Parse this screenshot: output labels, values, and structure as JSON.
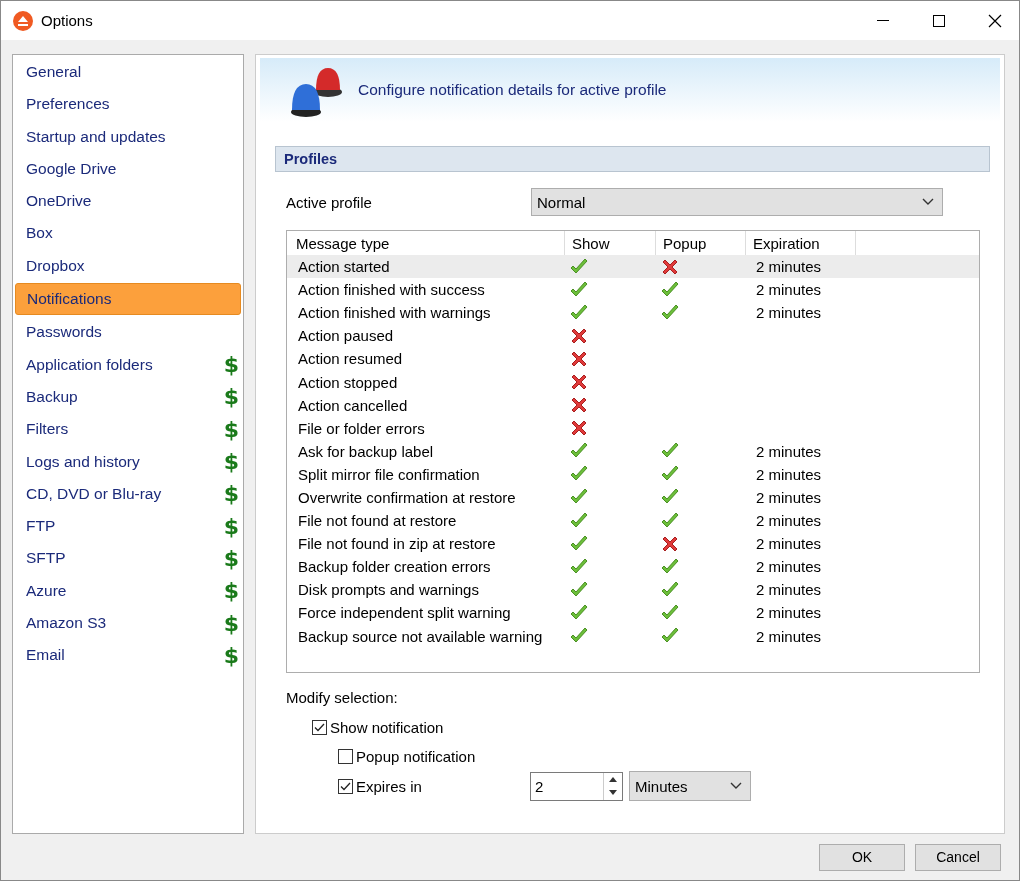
{
  "window": {
    "title": "Options"
  },
  "sidebar": {
    "items": [
      {
        "label": "General",
        "selected": false
      },
      {
        "label": "Preferences",
        "selected": false
      },
      {
        "label": "Startup and updates",
        "selected": false
      },
      {
        "label": "Google Drive",
        "selected": false
      },
      {
        "label": "OneDrive",
        "selected": false
      },
      {
        "label": "Box",
        "selected": false
      },
      {
        "label": "Dropbox",
        "selected": false
      },
      {
        "label": "Notifications",
        "selected": true
      },
      {
        "label": "Passwords",
        "selected": false
      },
      {
        "label": "Application folders",
        "selected": false,
        "badge": "$"
      },
      {
        "label": "Backup",
        "selected": false,
        "badge": "$"
      },
      {
        "label": "Filters",
        "selected": false,
        "badge": "$"
      },
      {
        "label": "Logs and history",
        "selected": false,
        "badge": "$"
      },
      {
        "label": "CD, DVD or Blu-ray",
        "selected": false,
        "badge": "$"
      },
      {
        "label": "FTP",
        "selected": false,
        "badge": "$"
      },
      {
        "label": "SFTP",
        "selected": false,
        "badge": "$"
      },
      {
        "label": "Azure",
        "selected": false,
        "badge": "$"
      },
      {
        "label": "Amazon S3",
        "selected": false,
        "badge": "$"
      },
      {
        "label": "Email",
        "selected": false,
        "badge": "$"
      }
    ]
  },
  "header": {
    "text": "Configure notification details for active profile"
  },
  "section": {
    "title": "Profiles"
  },
  "active_profile": {
    "label": "Active profile",
    "value": "Normal"
  },
  "table": {
    "columns": [
      "Message type",
      "Show",
      "Popup",
      "Expiration"
    ],
    "rows": [
      {
        "message": "Action started",
        "show": true,
        "popup": false,
        "expiration": "2 minutes",
        "selected": true
      },
      {
        "message": "Action finished with success",
        "show": true,
        "popup": true,
        "expiration": "2 minutes",
        "selected": false
      },
      {
        "message": "Action finished with warnings",
        "show": true,
        "popup": true,
        "expiration": "2 minutes",
        "selected": false
      },
      {
        "message": "Action paused",
        "show": false,
        "selected": false
      },
      {
        "message": "Action resumed",
        "show": false,
        "selected": false
      },
      {
        "message": "Action stopped",
        "show": false,
        "selected": false
      },
      {
        "message": "Action cancelled",
        "show": false,
        "selected": false
      },
      {
        "message": "File or folder errors",
        "show": false,
        "selected": false
      },
      {
        "message": "Ask for backup label",
        "show": true,
        "popup": true,
        "expiration": "2 minutes",
        "selected": false
      },
      {
        "message": "Split mirror file confirmation",
        "show": true,
        "popup": true,
        "expiration": "2 minutes",
        "selected": false
      },
      {
        "message": "Overwrite confirmation at restore",
        "show": true,
        "popup": true,
        "expiration": "2 minutes",
        "selected": false
      },
      {
        "message": "File not found at restore",
        "show": true,
        "popup": true,
        "expiration": "2 minutes",
        "selected": false
      },
      {
        "message": "File not found in zip at restore",
        "show": true,
        "popup": false,
        "expiration": "2 minutes",
        "selected": false
      },
      {
        "message": "Backup folder creation errors",
        "show": true,
        "popup": true,
        "expiration": "2 minutes",
        "selected": false
      },
      {
        "message": "Disk prompts and warnings",
        "show": true,
        "popup": true,
        "expiration": "2 minutes",
        "selected": false
      },
      {
        "message": "Force independent split warning",
        "show": true,
        "popup": true,
        "expiration": "2 minutes",
        "selected": false
      },
      {
        "message": "Backup source not available warning",
        "show": true,
        "popup": true,
        "expiration": "2 minutes",
        "selected": false
      }
    ]
  },
  "modify": {
    "label": "Modify selection:",
    "show_notification": {
      "label": "Show notification",
      "checked": true
    },
    "popup_notification": {
      "label": "Popup notification",
      "checked": false
    },
    "expires_in": {
      "label": "Expires in",
      "checked": true,
      "value": "2",
      "unit": "Minutes"
    }
  },
  "buttons": [
    "OK",
    "Cancel"
  ]
}
